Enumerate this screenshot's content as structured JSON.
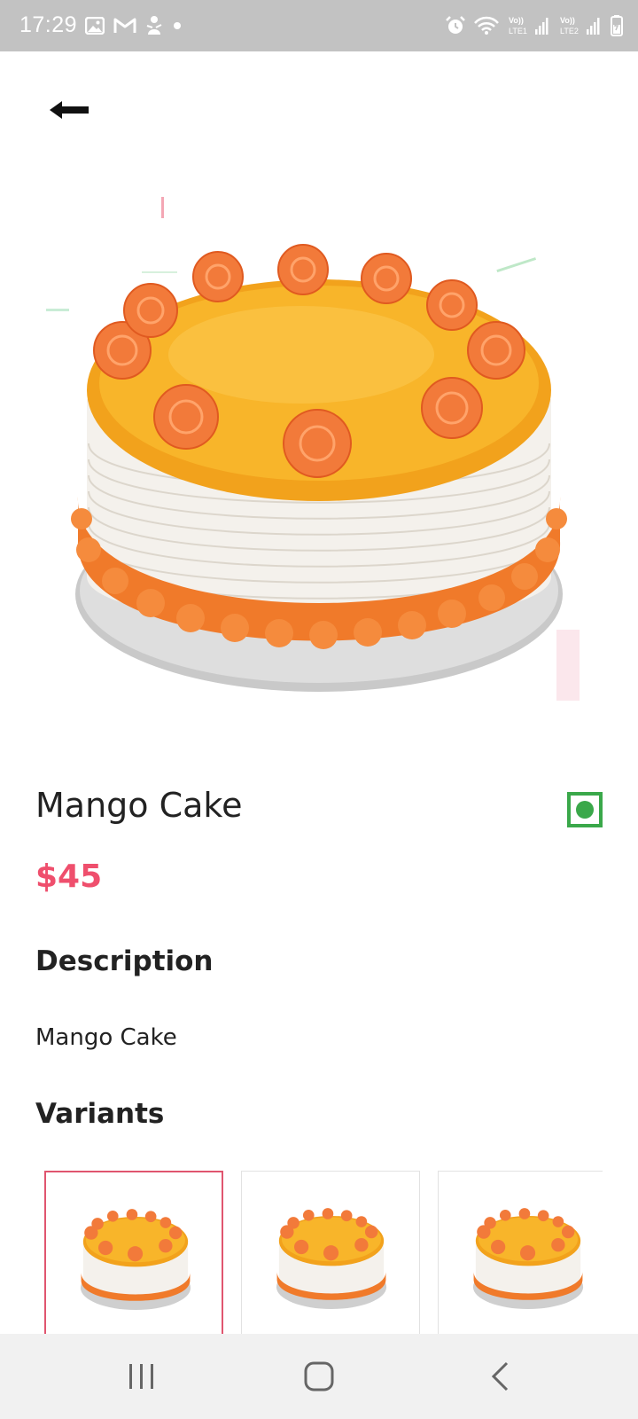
{
  "status_bar": {
    "time": "17:29",
    "icons_left": [
      "gallery-icon",
      "gmail-icon",
      "figure-icon",
      "dot-icon"
    ],
    "icons_right": [
      "alarm-icon",
      "wifi-icon",
      "signal-lte1-icon",
      "signal-lte2-icon",
      "battery-icon"
    ],
    "lte1_label": "LTE1",
    "lte2_label": "LTE2",
    "volte_label": "Vo))"
  },
  "header": {
    "back_icon": "left-arrow-icon"
  },
  "product": {
    "image_icon": "mango-cake-image",
    "title": "Mango Cake",
    "price": "$45",
    "veg_indicator_color": "#3aa84a"
  },
  "description": {
    "heading": "Description",
    "text": "Mango Cake"
  },
  "variants": {
    "heading": "Variants",
    "items": [
      {
        "image": "mango-cake-thumbnail",
        "selected": true
      },
      {
        "image": "mango-cake-thumbnail",
        "selected": false
      },
      {
        "image": "mango-cake-thumbnail",
        "selected": false
      }
    ]
  },
  "nav_bar": {
    "recents_icon": "recents-icon",
    "home_icon": "home-icon",
    "back_icon": "back-icon"
  },
  "colors": {
    "accent": "#ef4f6d",
    "veg_green": "#3aa84a",
    "status_bar": "#c2c2c2",
    "nav_bar": "#f1f1f1"
  }
}
